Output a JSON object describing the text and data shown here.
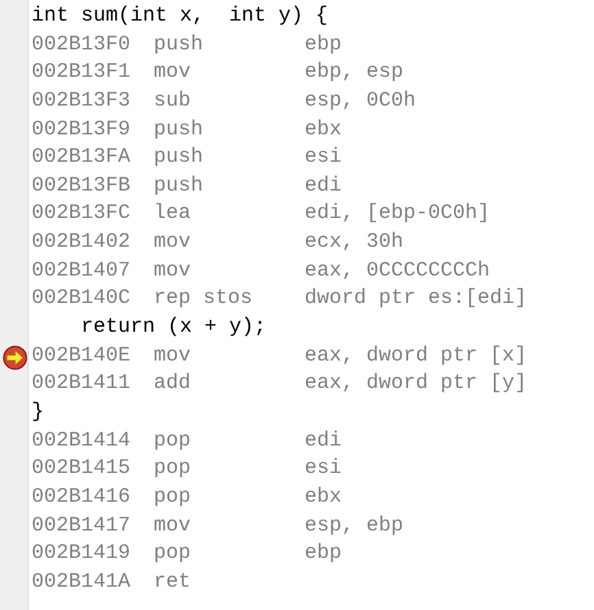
{
  "lines": [
    {
      "kind": "source",
      "text": "int sum(int x,  int y) {"
    },
    {
      "kind": "asm",
      "address": "002B13F0",
      "mnemonic": "push",
      "operands": "ebp",
      "current": false
    },
    {
      "kind": "asm",
      "address": "002B13F1",
      "mnemonic": "mov",
      "operands": "ebp, esp",
      "current": false
    },
    {
      "kind": "asm",
      "address": "002B13F3",
      "mnemonic": "sub",
      "operands": "esp, 0C0h",
      "current": false
    },
    {
      "kind": "asm",
      "address": "002B13F9",
      "mnemonic": "push",
      "operands": "ebx",
      "current": false
    },
    {
      "kind": "asm",
      "address": "002B13FA",
      "mnemonic": "push",
      "operands": "esi",
      "current": false
    },
    {
      "kind": "asm",
      "address": "002B13FB",
      "mnemonic": "push",
      "operands": "edi",
      "current": false
    },
    {
      "kind": "asm",
      "address": "002B13FC",
      "mnemonic": "lea",
      "operands": "edi, [ebp-0C0h]",
      "current": false
    },
    {
      "kind": "asm",
      "address": "002B1402",
      "mnemonic": "mov",
      "operands": "ecx, 30h",
      "current": false
    },
    {
      "kind": "asm",
      "address": "002B1407",
      "mnemonic": "mov",
      "operands": "eax, 0CCCCCCCCh",
      "current": false
    },
    {
      "kind": "asm",
      "address": "002B140C",
      "mnemonic": "rep stos",
      "operands": "dword ptr es:[edi]",
      "current": false
    },
    {
      "kind": "source",
      "text": "    return (x + y);"
    },
    {
      "kind": "asm",
      "address": "002B140E",
      "mnemonic": "mov",
      "operands": "eax, dword ptr [x]",
      "current": true
    },
    {
      "kind": "asm",
      "address": "002B1411",
      "mnemonic": "add",
      "operands": "eax, dword ptr [y]",
      "current": false
    },
    {
      "kind": "source",
      "text": "}"
    },
    {
      "kind": "asm",
      "address": "002B1414",
      "mnemonic": "pop",
      "operands": "edi",
      "current": false
    },
    {
      "kind": "asm",
      "address": "002B1415",
      "mnemonic": "pop",
      "operands": "esi",
      "current": false
    },
    {
      "kind": "asm",
      "address": "002B1416",
      "mnemonic": "pop",
      "operands": "ebx",
      "current": false
    },
    {
      "kind": "asm",
      "address": "002B1417",
      "mnemonic": "mov",
      "operands": "esp, ebp",
      "current": false
    },
    {
      "kind": "asm",
      "address": "002B1419",
      "mnemonic": "pop",
      "operands": "ebp",
      "current": false
    },
    {
      "kind": "asm",
      "address": "002B141A",
      "mnemonic": "ret"
    }
  ]
}
